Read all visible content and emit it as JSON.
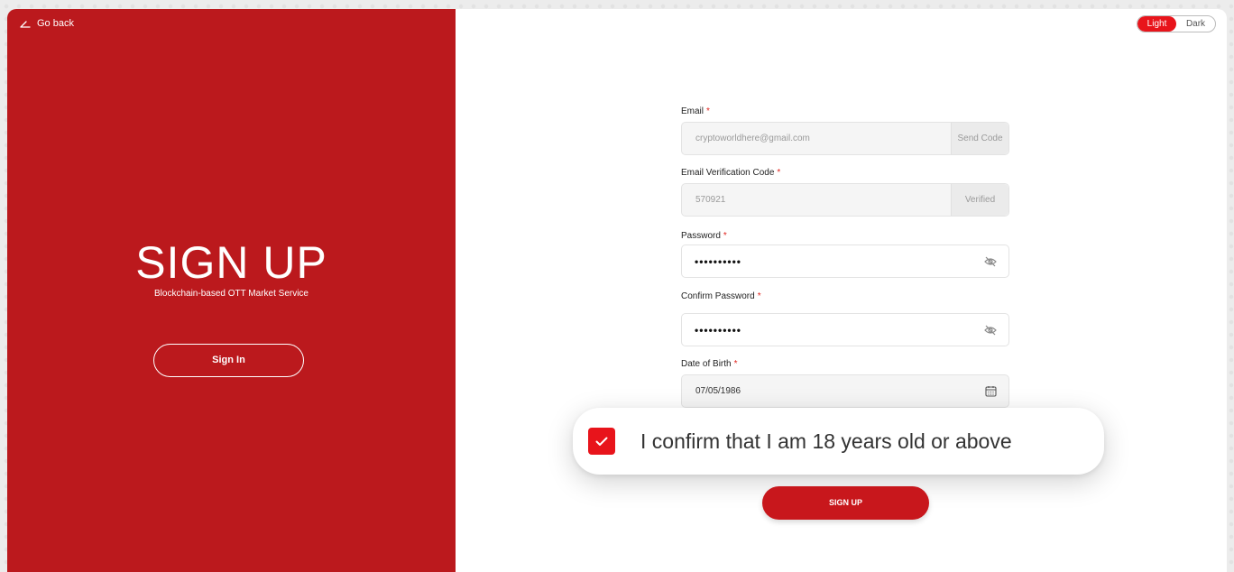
{
  "left_panel": {
    "go_back": "Go back",
    "title": "SIGN UP",
    "subtitle": "Blockchain-based OTT Market Service",
    "sign_in": "Sign In"
  },
  "theme": {
    "light": "Light",
    "dark": "Dark",
    "active": "Light"
  },
  "form": {
    "email": {
      "label": "Email",
      "required": "*",
      "value": "cryptoworldhere@gmail.com",
      "action": "Send Code"
    },
    "verification": {
      "label": "Email Verification Code",
      "required": "*",
      "value": "570921",
      "status": "Verified"
    },
    "password": {
      "label": "Password",
      "required": "*",
      "value": "••••••••••",
      "icon": "eye-off-icon"
    },
    "confirm_password": {
      "label": "Confirm Password",
      "required": "*",
      "value": "••••••••••",
      "icon": "eye-off-icon"
    },
    "dob": {
      "label": "Date of Birth",
      "required": "*",
      "value": "07/05/1986",
      "icon": "calendar-icon"
    },
    "age_confirm": {
      "text": "I confirm that I am 18 years old or above",
      "checked": true
    },
    "submit": "SIGN UP"
  },
  "colors": {
    "brand_red": "#bb191d",
    "accent_red": "#e8141b"
  }
}
